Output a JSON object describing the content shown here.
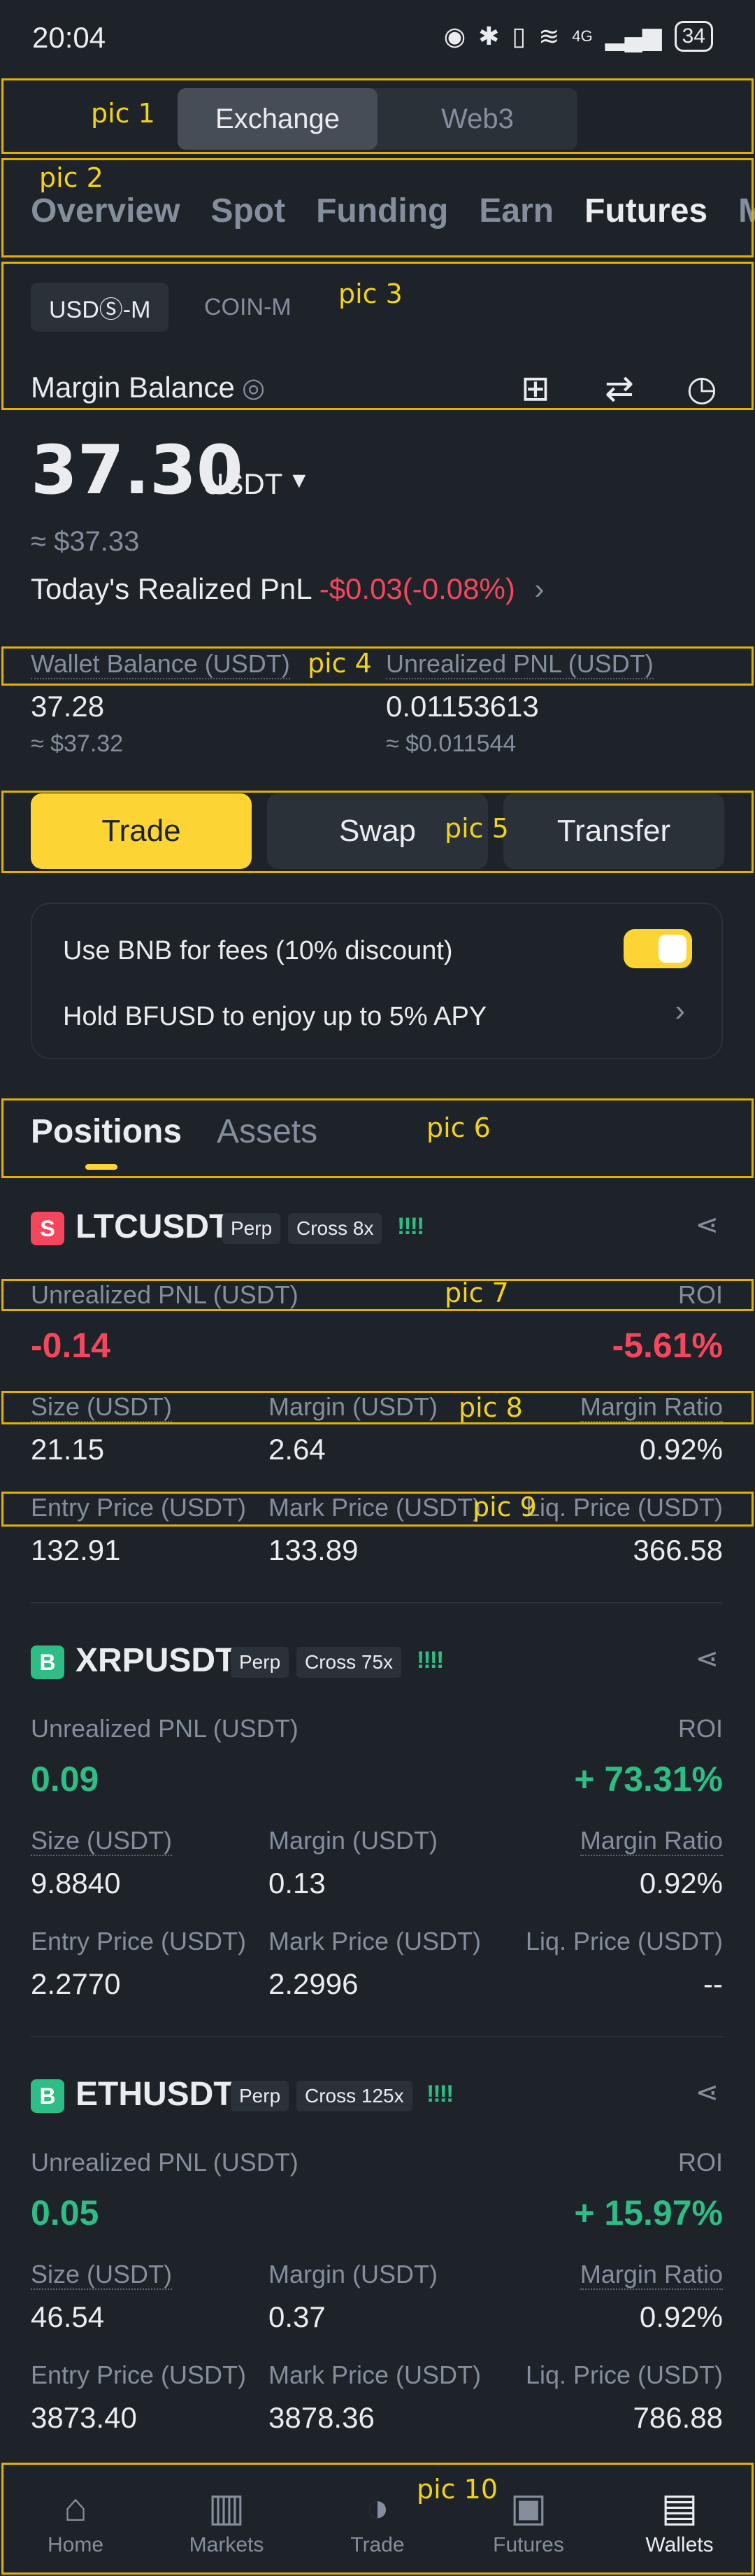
{
  "status_bar": {
    "time": "20:04",
    "network": "4G",
    "battery": "34"
  },
  "annotations": [
    "pic 1",
    "pic 2",
    "pic 3",
    "pic 4",
    "pic 5",
    "pic 6",
    "pic 7",
    "pic 8",
    "pic 9",
    "pic 10"
  ],
  "top_segment": {
    "tabs": [
      "Exchange",
      "Web3"
    ],
    "active": "Exchange"
  },
  "nav_tabs": [
    "Overview",
    "Spot",
    "Funding",
    "Earn",
    "Futures",
    "M"
  ],
  "margin_type": {
    "usdm": "USDⓈ-M",
    "coinm": "COIN-M"
  },
  "balance": {
    "label": "Margin Balance",
    "amount": "37.30",
    "unit": "USDT",
    "approx": "≈ $37.33",
    "pnl_label": "Today's Realized PnL",
    "pnl_value": "-$0.03(-0.08%)"
  },
  "wallet": {
    "wallet_label": "Wallet Balance (USDT)",
    "wallet_value": "37.28",
    "wallet_approx": "≈ $37.32",
    "unreal_label": "Unrealized PNL (USDT)",
    "unreal_value": "0.01153613",
    "unreal_approx": "≈ $0.011544"
  },
  "actions": {
    "trade": "Trade",
    "swap": "Swap",
    "transfer": "Transfer"
  },
  "promo": {
    "bnb": "Use BNB for fees (10% discount)",
    "bfusd": "Hold BFUSD to enjoy up to 5% APY"
  },
  "position_tabs": {
    "positions": "Positions",
    "assets": "Assets"
  },
  "labels": {
    "unreal": "Unrealized PNL (USDT)",
    "roi": "ROI",
    "size": "Size (USDT)",
    "margin": "Margin (USDT)",
    "margin_ratio": "Margin Ratio",
    "entry": "Entry Price (USDT)",
    "mark": "Mark Price (USDT)",
    "liq": "Liq. Price (USDT)"
  },
  "positions": [
    {
      "side": "S",
      "symbol": "LTCUSDT",
      "type": "Perp",
      "lev": "Cross 8x",
      "pnl": "-0.14",
      "roi": "-5.61%",
      "size": "21.15",
      "margin": "2.64",
      "ratio": "0.92%",
      "entry": "132.91",
      "mark": "133.89",
      "liq": "366.58"
    },
    {
      "side": "B",
      "symbol": "XRPUSDT",
      "type": "Perp",
      "lev": "Cross 75x",
      "pnl": "0.09",
      "roi": "+ 73.31%",
      "size": "9.8840",
      "margin": "0.13",
      "ratio": "0.92%",
      "entry": "2.2770",
      "mark": "2.2996",
      "liq": "--"
    },
    {
      "side": "B",
      "symbol": "ETHUSDT",
      "type": "Perp",
      "lev": "Cross 125x",
      "pnl": "0.05",
      "roi": "+ 15.97%",
      "size": "46.54",
      "margin": "0.37",
      "ratio": "0.92%",
      "entry": "3873.40",
      "mark": "3878.36",
      "liq": "786.88"
    }
  ],
  "bottom_nav": [
    "Home",
    "Markets",
    "Trade",
    "Futures",
    "Wallets"
  ],
  "colors": {
    "accent": "#fcd535",
    "buy": "#2ebd85",
    "sell": "#f6465d",
    "bg": "#1e2329",
    "annotation": "#e2b100"
  }
}
